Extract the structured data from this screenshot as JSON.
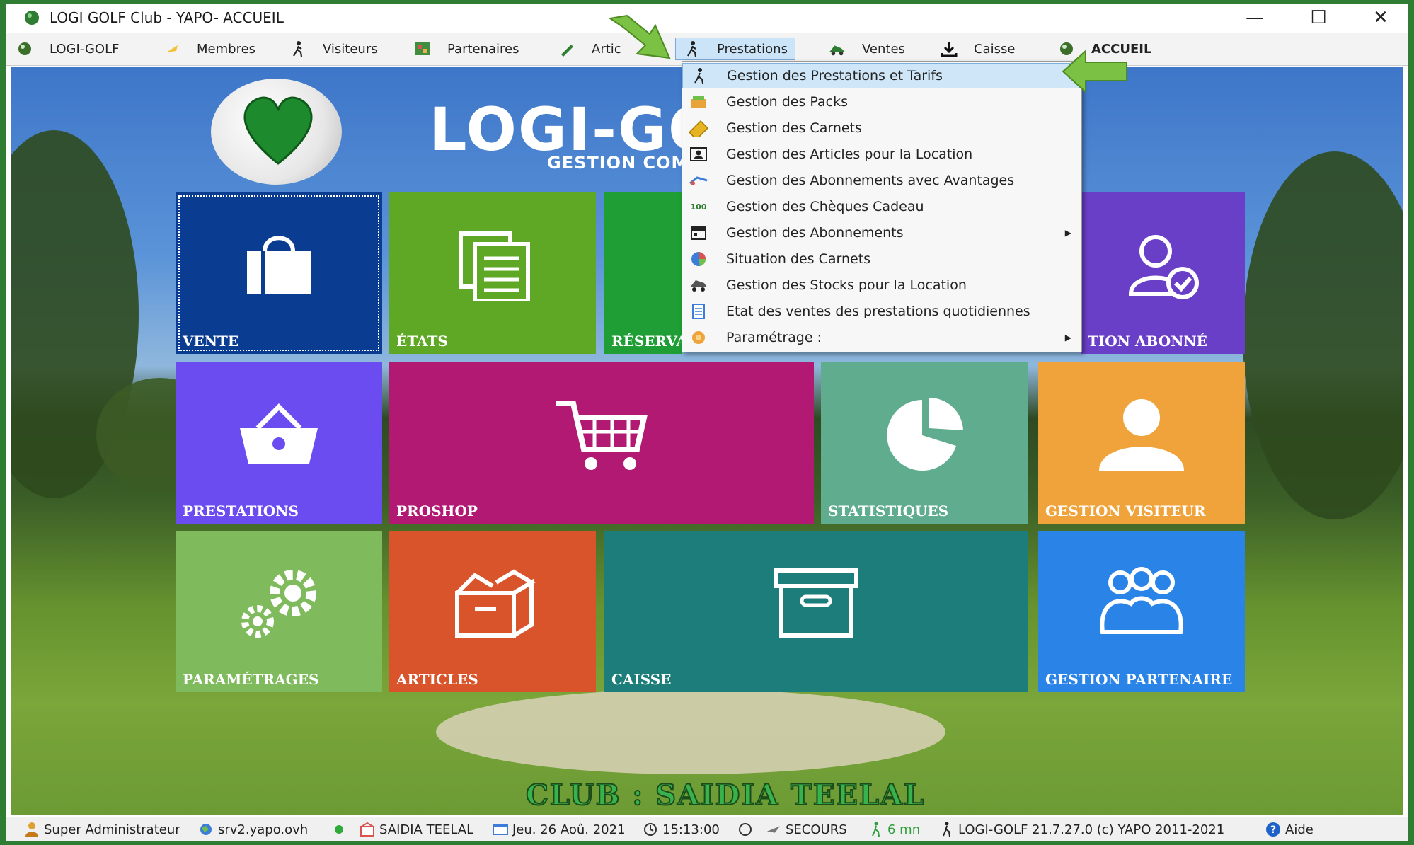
{
  "window": {
    "title": "LOGI GOLF Club - YAPO- ACCUEIL",
    "minimize": "—",
    "maximize": "☐",
    "close": "✕"
  },
  "menubar": {
    "items": [
      {
        "label": "LOGI-GOLF"
      },
      {
        "label": "Membres"
      },
      {
        "label": "Visiteurs"
      },
      {
        "label": "Partenaires"
      },
      {
        "label": "Artic"
      },
      {
        "label": "Prestations"
      },
      {
        "label": "Ventes"
      },
      {
        "label": "Caisse"
      },
      {
        "label": "ACCUEIL"
      }
    ]
  },
  "logo": {
    "title": "LOGI-GO",
    "subtitle": "GESTION COM"
  },
  "dropdown": {
    "items": [
      {
        "label": "Gestion des Prestations et Tarifs"
      },
      {
        "label": "Gestion des Packs"
      },
      {
        "label": "Gestion des Carnets"
      },
      {
        "label": "Gestion des Articles pour la Location"
      },
      {
        "label": "Gestion des Abonnements avec Avantages"
      },
      {
        "label": "Gestion des Chèques Cadeau"
      },
      {
        "label": "Gestion des Abonnements"
      },
      {
        "label": "Situation des Carnets"
      },
      {
        "label": "Gestion des Stocks pour la Location"
      },
      {
        "label": "Etat des ventes des prestations quotidiennes"
      },
      {
        "label": "Paramétrage :"
      }
    ],
    "check_icon_text": "100"
  },
  "tiles": {
    "vente": "VENTE",
    "etats": "ÉTATS",
    "reservation": "RÉSERVA",
    "abonne": "TION ABONNÉ",
    "prestations": "PRESTATIONS",
    "proshop": "PROSHOP",
    "statistiques": "STATISTIQUES",
    "visiteur": "GESTION VISITEUR",
    "parametrages": "PARAMÉTRAGES",
    "articles": "ARTICLES",
    "caisse": "CAISSE",
    "partenaire": "GESTION PARTENAIRE"
  },
  "club": "CLUB : SAIDIA TEELAL",
  "statusbar": {
    "user": "Super Administrateur",
    "server": "srv2.yapo.ovh",
    "site": "SAIDIA TEELAL",
    "date": "Jeu. 26 Aoû. 2021",
    "time": "15:13:00",
    "secours": "SECOURS",
    "duration": "6 mn",
    "version": "LOGI-GOLF 21.7.27.0  (c) YAPO 2011-2021",
    "help": "Aide"
  },
  "colors": {
    "vente": "#0a3d91",
    "etats": "#5fa825",
    "reservation": "#1e9e34",
    "abonne": "#6a3fc8",
    "prestations": "#6a4cf0",
    "proshop": "#b11973",
    "statistiques": "#5fac8e",
    "visiteur": "#f0a33a",
    "parametrages": "#7fba5c",
    "articles": "#d9542a",
    "caisse": "#1d7d7a",
    "partenaire": "#2a84e8",
    "arrow": "#7bc143"
  }
}
